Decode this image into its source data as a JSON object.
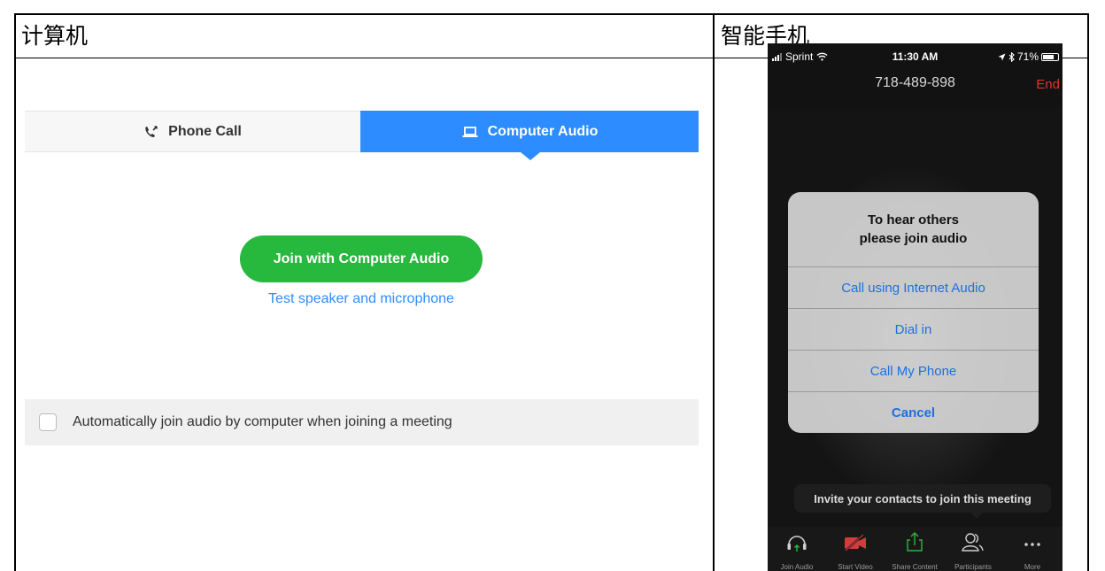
{
  "doc": {
    "header_left": "计算机",
    "header_right": "智能手机"
  },
  "computer": {
    "tabs": [
      {
        "label": "Phone Call",
        "icon": "phone-icon",
        "selected": false
      },
      {
        "label": "Computer Audio",
        "icon": "laptop-icon",
        "selected": true
      }
    ],
    "join_button": "Join with Computer Audio",
    "test_link": "Test speaker and microphone",
    "auto_join_label": "Automatically join audio by computer when joining a meeting",
    "auto_join_checked": false,
    "colors": {
      "accent": "#2d8cff",
      "join": "#27b83e"
    }
  },
  "phone": {
    "status": {
      "carrier": "Sprint",
      "time": "11:30 AM",
      "battery": "71%"
    },
    "meeting_id": "718-489-898",
    "end_label": "End",
    "dialog": {
      "title_line1": "To hear others",
      "title_line2": "please join audio",
      "options": [
        "Call using Internet Audio",
        "Dial in",
        "Call My Phone"
      ],
      "cancel": "Cancel"
    },
    "invite_tip": "Invite your contacts to join this meeting",
    "toolbar": [
      {
        "label": "Join Audio",
        "icon": "headphones-icon"
      },
      {
        "label": "Start Video",
        "icon": "video-off-icon"
      },
      {
        "label": "Share Content",
        "icon": "share-icon"
      },
      {
        "label": "Participants",
        "icon": "participants-icon"
      },
      {
        "label": "More",
        "icon": "more-icon"
      }
    ],
    "colors": {
      "end": "#e0332d",
      "link": "#1e6fe0"
    }
  }
}
